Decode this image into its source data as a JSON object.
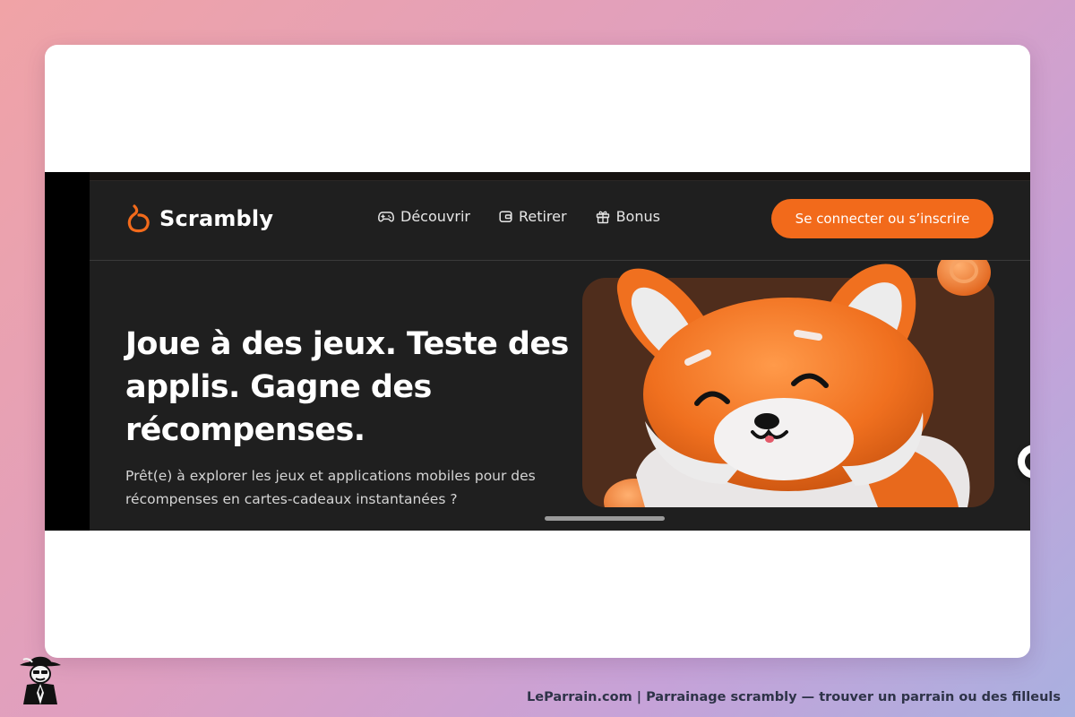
{
  "site": {
    "logo_text": "Scrambly",
    "nav": [
      {
        "label": "Découvrir",
        "icon": "gamepad-icon"
      },
      {
        "label": "Retirer",
        "icon": "wallet-icon"
      },
      {
        "label": "Bonus",
        "icon": "gift-icon"
      }
    ],
    "cta_label": "Se connecter ou s’inscrire",
    "hero": {
      "title": "Joue à des jeux. Teste des applis. Gagne des récompenses.",
      "subtitle": "Prêt(e) à explorer les jeux et applications mobiles pour des récompenses en cartes-cadeaux instantanées ?"
    },
    "help_label": "?"
  },
  "footer": {
    "caption": "LeParrain.com | Parrainage scrambly — trouver un parrain ou des filleuls"
  },
  "colors": {
    "accent": "#f26a1b",
    "site_background": "#1f1f1f",
    "hero_art_background": "#4f2d1c"
  }
}
